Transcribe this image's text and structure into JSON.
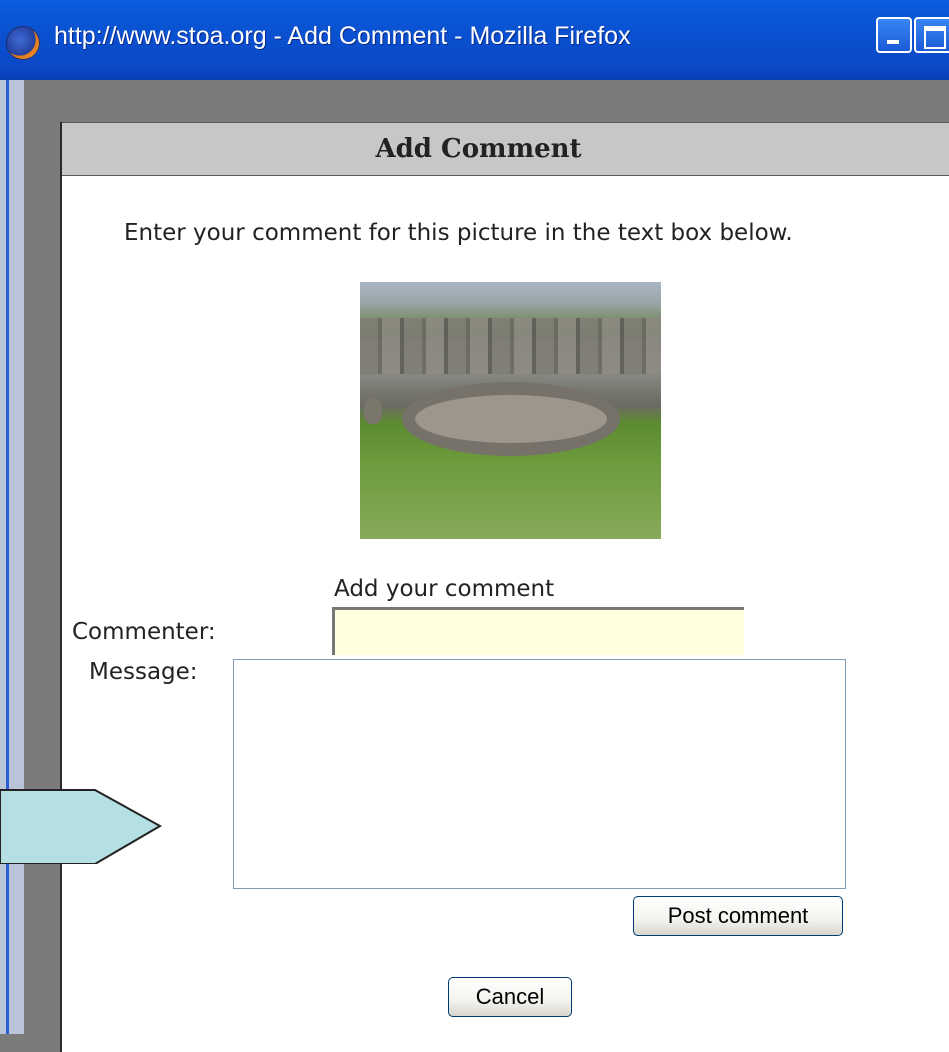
{
  "window": {
    "title": "http://www.stoa.org - Add Comment - Mozilla Firefox"
  },
  "dialog": {
    "title": "Add Comment",
    "intro": "Enter your comment for this picture in the text box below.",
    "section_label": "Add your comment",
    "commenter_label": "Commenter:",
    "commenter_value": "",
    "message_label": "Message:",
    "message_value": "",
    "post_button": "Post comment",
    "cancel_button": "Cancel"
  },
  "colors": {
    "titlebar": "#0a4fcf",
    "header_bg": "#c7c7c7",
    "commenter_bg": "#ffffe0",
    "callout_fill": "#b5e0e3"
  },
  "icons": {
    "browser": "firefox-icon",
    "minimize": "minimize-icon",
    "maximize": "maximize-icon"
  }
}
